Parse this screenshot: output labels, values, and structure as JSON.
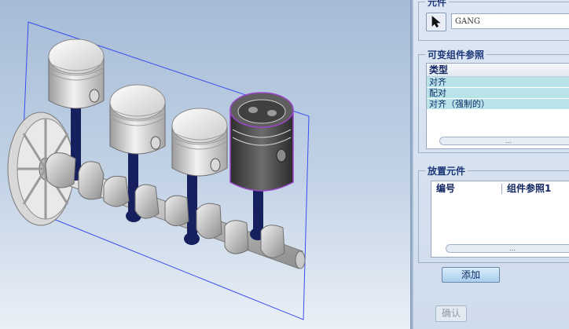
{
  "panel": {
    "component_section": {
      "legend": "元件",
      "pick_icon": "arrow-cursor-icon",
      "reference_value": "GANG"
    },
    "variable_refs": {
      "legend": "可变组件参照",
      "column_type": "类型",
      "rows": [
        "对齐",
        "配对",
        "对齐（强制的）"
      ],
      "scrollbar_grip": "…"
    },
    "place_component": {
      "legend": "放置元件",
      "column_number": "编号",
      "column_ref": "组件参照1",
      "scrollbar_grip": "…"
    },
    "add_button": "添加",
    "ok_button": "确认"
  },
  "colors": {
    "viewport_top": "#a6bcd6",
    "viewport_bottom": "#eaf0f7",
    "row_highlight": "#b9e3e8",
    "connecting_rod": "#17205e",
    "selection_plane": "#3a4df0",
    "selected_piston": "#4d4d4d"
  }
}
